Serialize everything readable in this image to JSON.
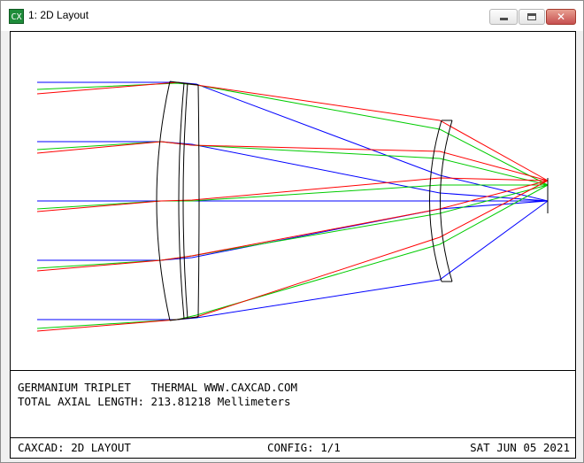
{
  "window": {
    "title": "1: 2D Layout",
    "icon": "caxcad-app-icon",
    "icon_text": "CX",
    "controls": {
      "minimize": "minimize-icon",
      "maximize": "maximize-icon",
      "close": "close-icon",
      "close_glyph": "✕"
    }
  },
  "info": {
    "line1": "GERMANIUM TRIPLET   THERMAL WWW.CAXCAD.COM",
    "line2": "TOTAL AXIAL LENGTH: 213.81218 Mellimeters"
  },
  "status": {
    "left": "CAXCAD: 2D LAYOUT",
    "middle": "CONFIG: 1/1",
    "right": "SAT JUN 05 2021"
  },
  "colors": {
    "red_rays": "#ff0000",
    "green_rays": "#00cc00",
    "blue_rays": "#0000ff",
    "lens": "#000000"
  }
}
